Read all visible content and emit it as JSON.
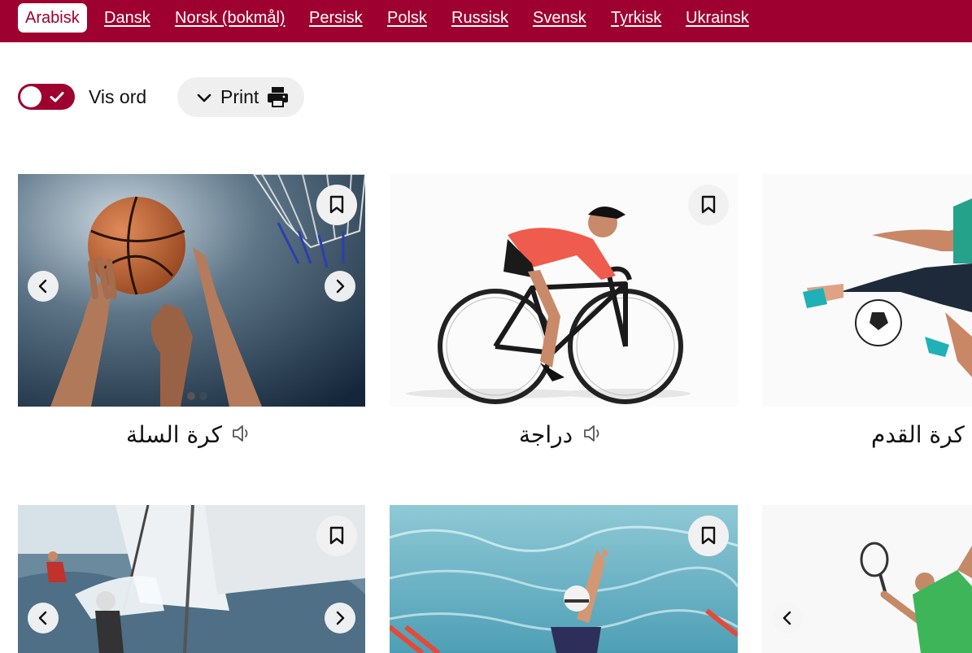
{
  "languages": [
    {
      "label": "Arabisk",
      "active": true
    },
    {
      "label": "Dansk"
    },
    {
      "label": "Norsk (bokmål)"
    },
    {
      "label": "Persisk"
    },
    {
      "label": "Polsk"
    },
    {
      "label": "Russisk"
    },
    {
      "label": "Svensk"
    },
    {
      "label": "Tyrkisk"
    },
    {
      "label": "Ukrainsk"
    }
  ],
  "toolbar": {
    "show_words_label": "Vis ord",
    "show_words_on": true,
    "print_label": "Print"
  },
  "cards": [
    {
      "word": "كرة السلة",
      "image": "basketball",
      "has_carousel": true
    },
    {
      "word": "دراجة",
      "image": "bicycle"
    },
    {
      "word": "كرة القدم",
      "image": "football"
    },
    {
      "word": "",
      "image": "sailing",
      "has_carousel": true
    },
    {
      "word": "",
      "image": "swimming"
    },
    {
      "word": "",
      "image": "tennis",
      "has_carousel": true
    }
  ],
  "colors": {
    "brand": "#9e0030",
    "button_bg": "#efefef"
  }
}
